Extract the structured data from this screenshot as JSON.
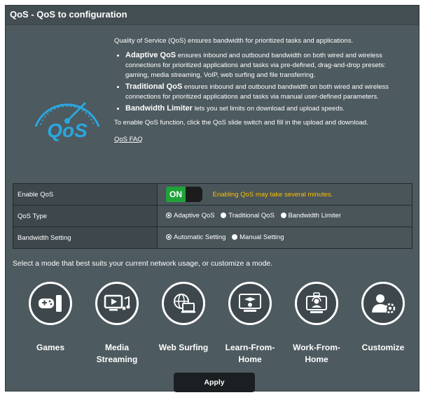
{
  "page": {
    "title": "QoS - QoS to configuration"
  },
  "intro": {
    "lead": "Quality of Service (QoS) ensures bandwidth for prioritized tasks and applications.",
    "bullets": [
      {
        "term": "Adaptive QoS",
        "text": " ensures inbound and outbound bandwidth on both wired and wireless connections for prioritized applications and tasks via pre-defined, drag-and-drop presets: gaming, media streaming, VoIP, web surfing and file transferring."
      },
      {
        "term": "Traditional QoS",
        "text": " ensures inbound and outbound bandwidth on both wired and wireless connections for prioritized applications and tasks via manual user-defined parameters."
      },
      {
        "term": "Bandwidth Limiter",
        "text": " lets you set limits on download and upload speeds."
      }
    ],
    "enable_note": "To enable QoS function, click the QoS slide switch and fill in the upload and download.",
    "faq_link": "QoS FAQ"
  },
  "logo": {
    "icon": "qos-speedometer-icon",
    "text": "QoS",
    "color": "#2aa7e0"
  },
  "settings": {
    "enable_qos": {
      "label": "Enable QoS",
      "toggle_text": "ON",
      "toggle_on": true,
      "warning": "Enabling QoS may take several minutes."
    },
    "qos_type": {
      "label": "QoS Type",
      "options": [
        "Adaptive QoS",
        "Traditional QoS",
        "Bandwidth Limiter"
      ],
      "selected": "Adaptive QoS"
    },
    "bandwidth": {
      "label": "Bandwidth Setting",
      "options": [
        "Automatic Setting",
        "Manual Setting"
      ],
      "selected": "Automatic Setting"
    }
  },
  "mode_prompt": "Select a mode that best suits your current network usage, or customize a mode.",
  "modes": [
    {
      "line1": "Games",
      "line2": "",
      "icon": "gamepad-icon"
    },
    {
      "line1": "Media",
      "line2": "Streaming",
      "icon": "media-streaming-icon"
    },
    {
      "line1": "Web Surfing",
      "line2": "",
      "icon": "web-surfing-icon"
    },
    {
      "line1": "Learn-From-",
      "line2": "Home",
      "icon": "learn-from-home-icon"
    },
    {
      "line1": "Work-From-",
      "line2": "Home",
      "icon": "work-from-home-icon"
    },
    {
      "line1": "Customize",
      "line2": "",
      "icon": "customize-icon"
    }
  ],
  "apply_label": "Apply",
  "colors": {
    "panel": "#4d5a5f",
    "accent_on": "#1fa23a",
    "warning": "#ffbf00"
  }
}
